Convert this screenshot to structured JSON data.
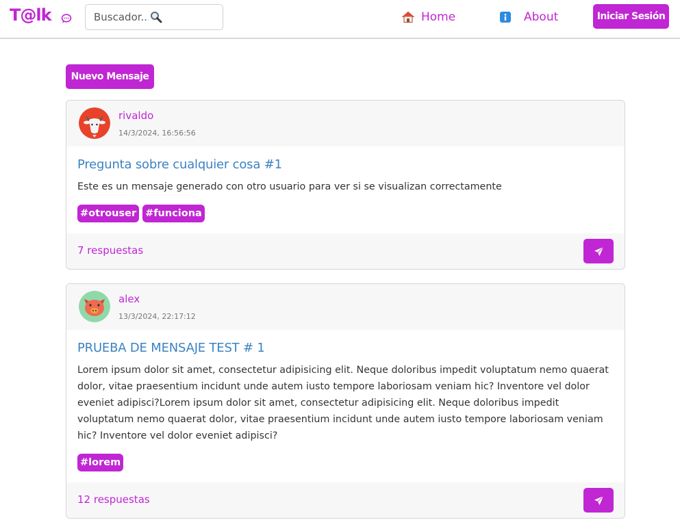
{
  "app": {
    "logo_text": "T@lk"
  },
  "search": {
    "placeholder": "Buscador..."
  },
  "nav": {
    "home_label": "Home",
    "about_label": "About",
    "login_label": "Iniciar Sesión"
  },
  "actions": {
    "new_message_label": "Nuevo Mensaje"
  },
  "messages": [
    {
      "username": "rivaldo",
      "timestamp": "14/3/2024, 16:56:56",
      "title": "Pregunta sobre cualquier cosa #1",
      "text": "Este es un mensaje generado con otro usuario para ver si se visualizan correctamente",
      "tags": [
        "#otrouser",
        "#funciona"
      ],
      "replies": "7 respuestas",
      "avatar_icon": "goat-avatar-icon"
    },
    {
      "username": "alex",
      "timestamp": "13/3/2024, 22:17:12",
      "title": "PRUEBA DE MENSAJE TEST # 1",
      "text": "Lorem ipsum dolor sit amet, consectetur adipisicing elit. Neque doloribus impedit voluptatum nemo quaerat dolor, vitae praesentium incidunt unde autem iusto tempore laboriosam veniam hic? Inventore vel dolor eveniet adipisci?Lorem ipsum dolor sit amet, consectetur adipisicing elit. Neque doloribus impedit voluptatum nemo quaerat dolor, vitae praesentium incidunt unde autem iusto tempore laboriosam veniam hic? Inventore vel dolor eveniet adipisci?",
      "tags": [
        "#lorem"
      ],
      "replies": "12 respuestas",
      "avatar_icon": "pig-avatar-icon"
    }
  ],
  "colors": {
    "accent": "#c026d3",
    "title_blue": "#3b82c4",
    "card_bg": "#f7f7f8"
  }
}
